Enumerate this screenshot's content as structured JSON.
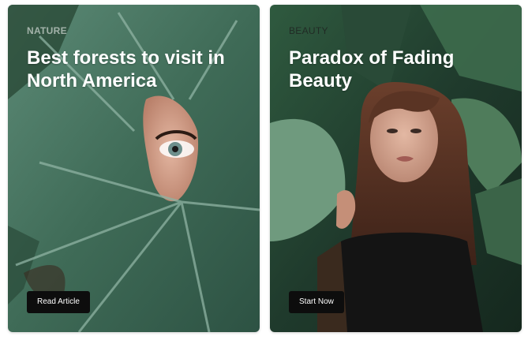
{
  "cards": [
    {
      "category": "NATURE",
      "title": "Best forests to visit in North America",
      "button_label": "Read Article"
    },
    {
      "category": "BEAUTY",
      "title": "Paradox of Fading Beauty",
      "button_label": "Start Now"
    }
  ],
  "colors": {
    "button_bg": "#0d0d0d",
    "button_text": "#ffffff",
    "title_text": "#ffffff",
    "leaf_green": "#3f6b57",
    "dark_foliage": "#1f3a2c"
  }
}
